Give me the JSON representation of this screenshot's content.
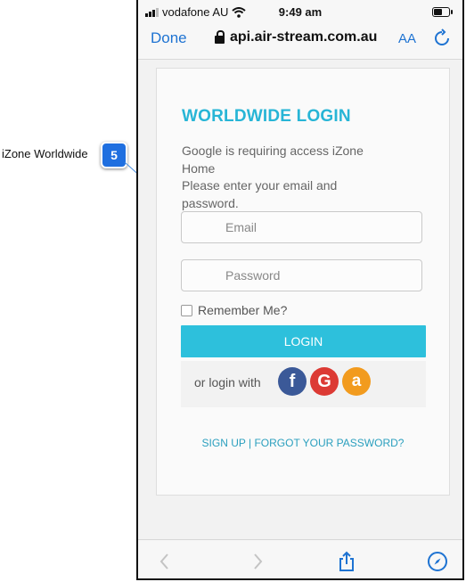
{
  "annotation": {
    "label": "iZone  Worldwide",
    "badge": "5"
  },
  "statusbar": {
    "carrier": "vodafone AU",
    "time": "9:49 am"
  },
  "addressbar": {
    "done": "Done",
    "url": "api.air-stream.com.au",
    "text_size": "AA"
  },
  "login": {
    "title": "WORLDWIDE LOGIN",
    "description_lines": [
      "Google is requiring access iZone",
      "Home",
      "Please enter your email and",
      "password."
    ],
    "email_placeholder": "Email",
    "password_placeholder": "Password",
    "remember_me": "Remember Me?",
    "login_button": "LOGIN",
    "or_login_with": "or login with",
    "social": {
      "facebook": "f",
      "google": "G",
      "amazon": "a"
    },
    "links": "SIGN UP | FORGOT YOUR PASSWORD?"
  },
  "colors": {
    "accent": "#2dc0dc",
    "title": "#27b5d6",
    "link_blue": "#1e73d2",
    "badge": "#1f6fe0"
  },
  "icons": [
    "signal-icon",
    "wifi-icon",
    "battery-icon",
    "lock-icon",
    "reload-icon",
    "back-icon",
    "forward-icon",
    "share-icon",
    "compass-icon"
  ]
}
